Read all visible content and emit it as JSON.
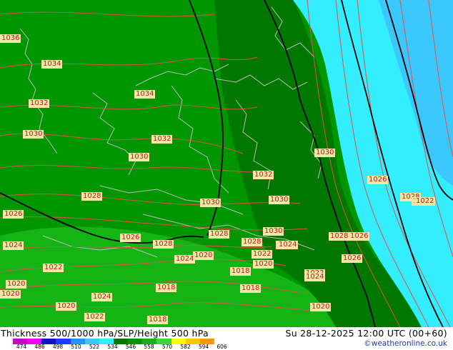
{
  "map": {
    "colors": {
      "cyan": "#33eeff",
      "light_blue": "#3cc8ff",
      "green_mid": "#009600",
      "green_dark": "#007800",
      "green_light": "#14b414",
      "label_bg": "#f4e6a6",
      "label_text": "#c8141e",
      "isohypse": "#000000",
      "isobar": "#e0504e",
      "border": "#bcbcbc"
    },
    "pressure_labels": [
      "1036",
      "1034",
      "1034",
      "1032",
      "1032",
      "1030",
      "1030",
      "1032",
      "1030",
      "1028",
      "1030",
      "1030",
      "1026",
      "1026",
      "1028",
      "1030",
      "1024",
      "1028",
      "1028",
      "1026",
      "1028",
      "1028",
      "1028",
      "1026",
      "1024",
      "1022",
      "1026",
      "1024",
      "1020",
      "1022",
      "1022",
      "1020",
      "1018",
      "1024",
      "1024",
      "1020",
      "1018",
      "1018",
      "1020",
      "1020",
      "1022",
      "1018",
      "1020",
      "1024",
      "1022"
    ]
  },
  "footer": {
    "title": "Thickness 500/1000 hPa/SLP/Height 500 hPa",
    "datetime": "Su 28-12-2025 12:00 UTC (00+60)",
    "credit": "©weatheronline.co.uk",
    "scale_labels": [
      "474",
      "486",
      "498",
      "510",
      "522",
      "534",
      "546",
      "558",
      "570",
      "582",
      "594",
      "606"
    ],
    "scale_colors": [
      "#c800c8",
      "#f000f0",
      "#1414b4",
      "#1e3cff",
      "#1e96ff",
      "#3cc8ff",
      "#33eeff",
      "#007800",
      "#009600",
      "#14b414",
      "#32dc32",
      "#ffff00",
      "#ffc800",
      "#ff9600"
    ]
  }
}
